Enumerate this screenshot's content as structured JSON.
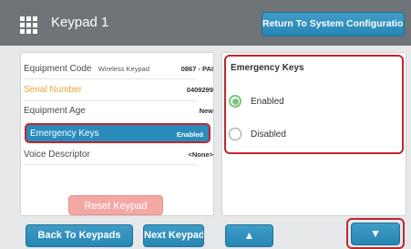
{
  "header": {
    "title": "Keypad 1",
    "return_label": "Return To System Configuration"
  },
  "details": {
    "rows": [
      {
        "label": "Equipment Code",
        "value": "0867 - PAI",
        "secondary": "Wireless Keypad"
      },
      {
        "label": "Serial Number",
        "value": "0409299"
      },
      {
        "label": "Equipment Age",
        "value": "New"
      },
      {
        "label": "Emergency Keys",
        "value": "Enabled"
      },
      {
        "label": "Voice Descriptor",
        "value": "<None>"
      }
    ],
    "reset_label": "Reset Keypad"
  },
  "emergency": {
    "title": "Emergency Keys",
    "options": [
      {
        "label": "Enabled",
        "selected": true
      },
      {
        "label": "Disabled",
        "selected": false
      }
    ]
  },
  "footer": {
    "back_label": "Back To Keypads",
    "next_label": "Next Keypad",
    "up_icon": "▲",
    "down_icon": "▼"
  },
  "colors": {
    "accent": "#2a8bbd",
    "highlight": "#c0272d",
    "serial_label": "#e8a33a",
    "radio_on": "#7cc47a"
  }
}
